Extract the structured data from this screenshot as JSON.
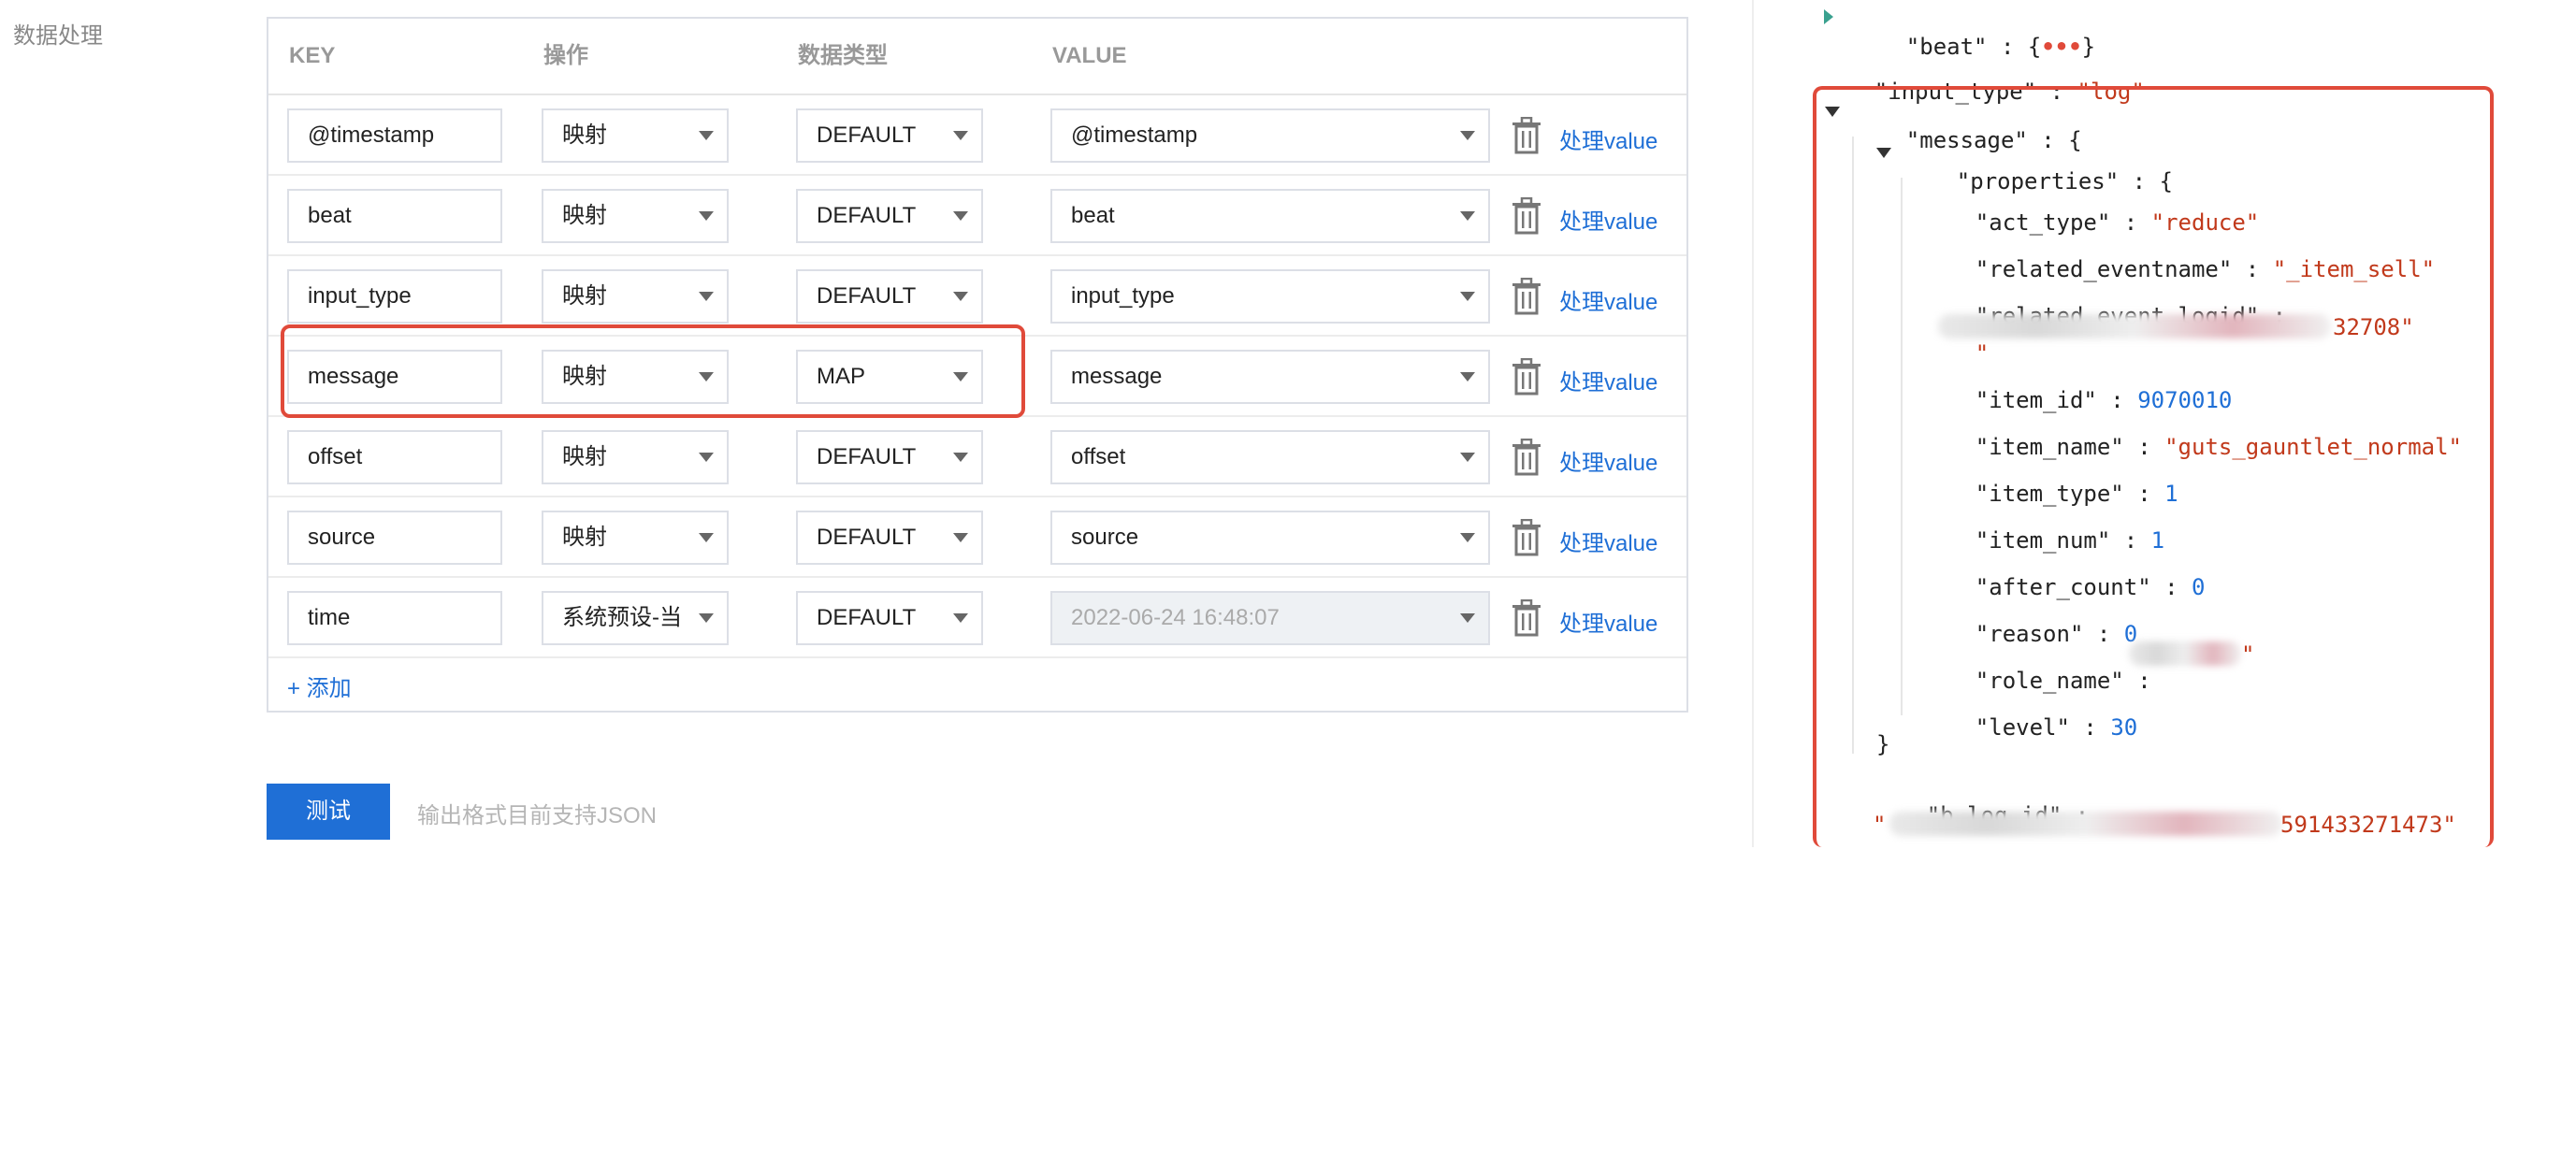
{
  "section_label": "数据处理",
  "table": {
    "headers": {
      "key": "KEY",
      "op": "操作",
      "type": "数据类型",
      "value": "VALUE"
    },
    "process_label": "处理value",
    "rows": [
      {
        "key": "@timestamp",
        "op": "映射",
        "type": "DEFAULT",
        "value": "@timestamp",
        "disabled": false
      },
      {
        "key": "beat",
        "op": "映射",
        "type": "DEFAULT",
        "value": "beat",
        "disabled": false
      },
      {
        "key": "input_type",
        "op": "映射",
        "type": "DEFAULT",
        "value": "input_type",
        "disabled": false
      },
      {
        "key": "message",
        "op": "映射",
        "type": "MAP",
        "value": "message",
        "disabled": false
      },
      {
        "key": "offset",
        "op": "映射",
        "type": "DEFAULT",
        "value": "offset",
        "disabled": false
      },
      {
        "key": "source",
        "op": "映射",
        "type": "DEFAULT",
        "value": "source",
        "disabled": false
      },
      {
        "key": "time",
        "op": "系统预设-当",
        "type": "DEFAULT",
        "value": "2022-06-24 16:48:07",
        "disabled": true
      }
    ],
    "add_label": "+ 添加"
  },
  "test_button": "测试",
  "output_hint": "输出格式目前支持JSON",
  "json_view": {
    "beat_key": "\"beat\"",
    "beat_brace_open": "{",
    "beat_dots": "•••",
    "beat_brace_close": "}",
    "input_type_key": "\"input_type\"",
    "input_type_val": "\"log\"",
    "message_key": "\"message\"",
    "properties_key": "\"properties\"",
    "act_type_key": "\"act_type\"",
    "act_type_val": "\"reduce\"",
    "related_eventname_key": "\"related_eventname\"",
    "related_eventname_val": "\"_item_sell\"",
    "related_event_logid_key": "\"related event logid\"",
    "related_event_logid_open": "\"",
    "related_event_logid_tail": "32708\"",
    "item_id_key": "\"item_id\"",
    "item_id_val": "9070010",
    "item_name_key": "\"item_name\"",
    "item_name_val": "\"guts_gauntlet_normal\"",
    "item_type_key": "\"item_type\"",
    "item_type_val": "1",
    "item_num_key": "\"item_num\"",
    "item_num_val": "1",
    "after_count_key": "\"after_count\"",
    "after_count_val": "0",
    "reason_key": "\"reason\"",
    "reason_val": "0",
    "role_name_key": "\"role_name\"",
    "role_name_tail": "\"",
    "level_key": "\"level\"",
    "level_val": "30",
    "properties_close": "}",
    "b_log_id_key": "\"b_log_id\"",
    "b_log_id_open": "\"",
    "b_log_id_tail": "591433271473\""
  },
  "colors": {
    "accent": "#1f6fd6",
    "highlight": "#e04a3a",
    "json_string": "#c1391b",
    "json_number": "#1f6fd6"
  }
}
